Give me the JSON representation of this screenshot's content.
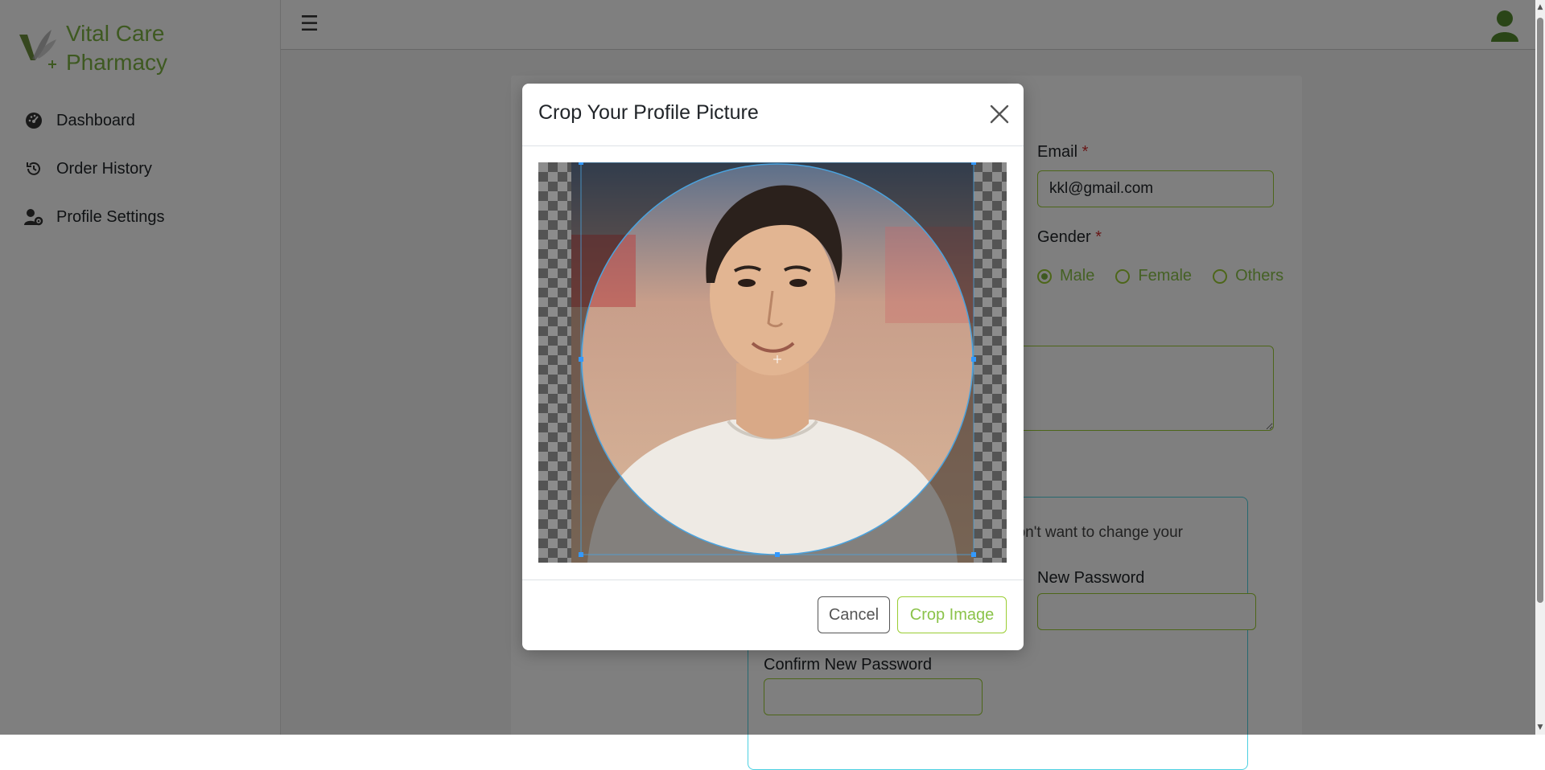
{
  "brand": {
    "name_line1": "Vital Care",
    "name_line2": "Pharmacy"
  },
  "sidebar": {
    "items": [
      {
        "label": "Dashboard",
        "icon": "dashboard-icon"
      },
      {
        "label": "Order History",
        "icon": "history-icon"
      },
      {
        "label": "Profile Settings",
        "icon": "user-gear-icon"
      }
    ]
  },
  "topbar": {
    "menu_glyph": "☰"
  },
  "form": {
    "email_label": "Email",
    "email_value": "kkl@gmail.com",
    "gender_label": "Gender",
    "gender_options": [
      "Male",
      "Female",
      "Others"
    ],
    "gender_selected": "Male",
    "required_mark": "*",
    "password_hint": "don't want to change your",
    "new_password_label": "New Password",
    "confirm_password_label": "Confirm New Password"
  },
  "modal": {
    "title": "Crop Your Profile Picture",
    "cancel_label": "Cancel",
    "crop_label": "Crop Image"
  },
  "colors": {
    "brand": "#7cb342",
    "accent_border": "#9acd32",
    "password_box_border": "#4dd0e1",
    "overlay": "rgba(0,0,0,0.5)"
  }
}
